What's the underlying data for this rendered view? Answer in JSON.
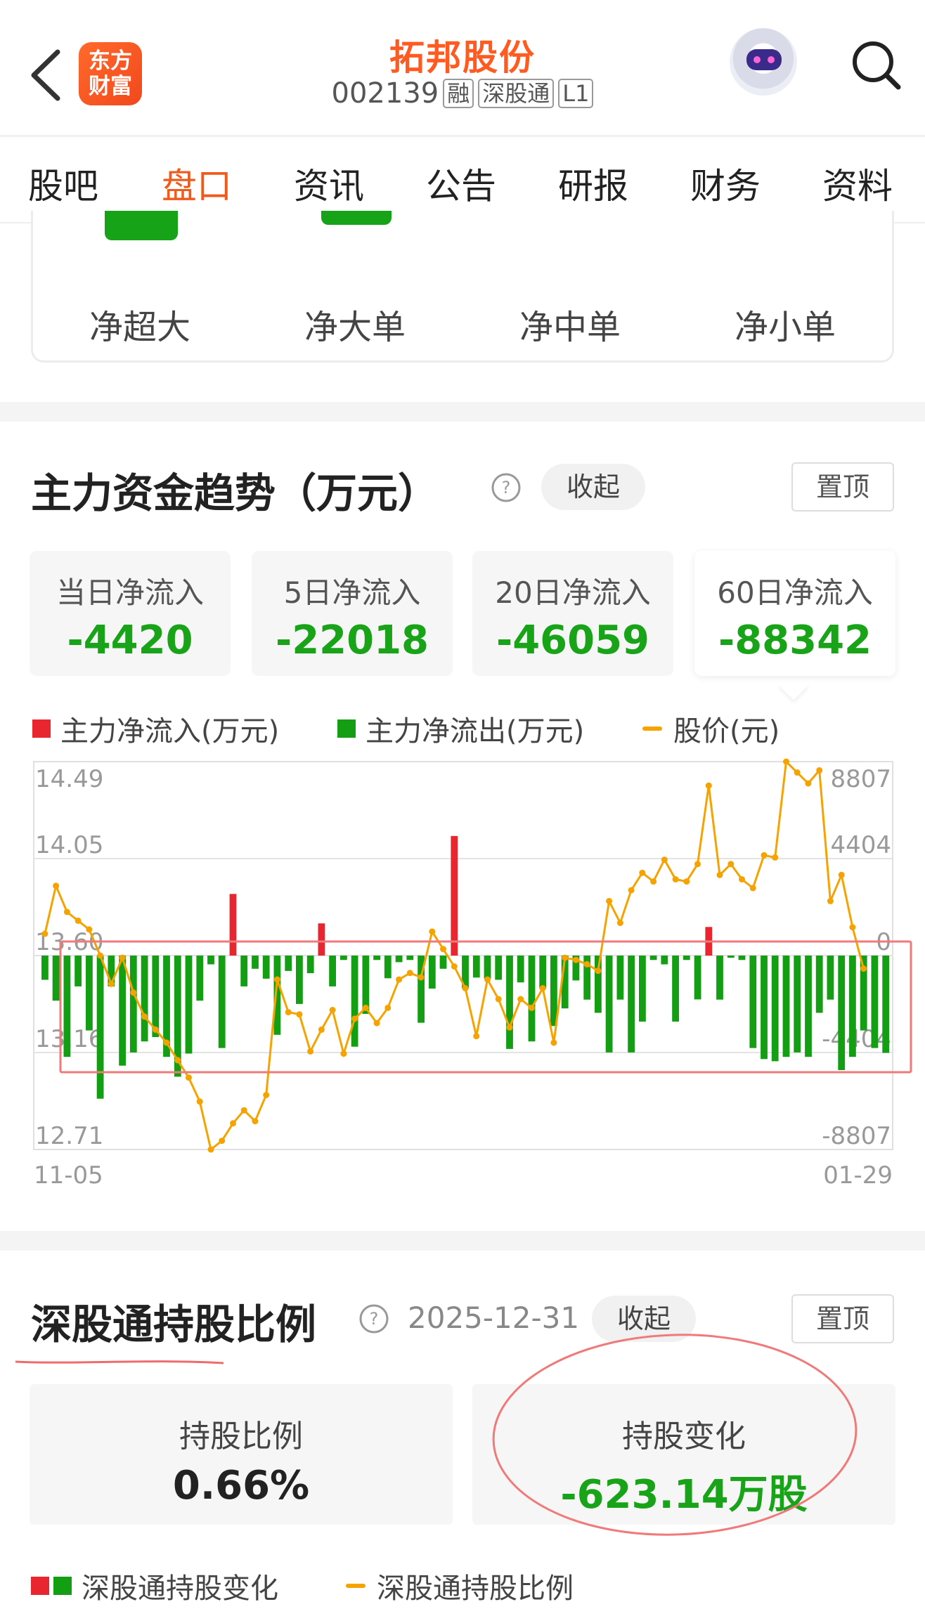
{
  "header": {
    "logo_line1": "东方",
    "logo_line2": "财富",
    "stock_name": "拓邦股份",
    "stock_code": "002139",
    "tags": [
      "融",
      "深股通",
      "L1"
    ]
  },
  "tabs": [
    "股吧",
    "盘口",
    "资讯",
    "公告",
    "研报",
    "财务",
    "资料"
  ],
  "active_tab": "盘口",
  "order_flow": {
    "labels": [
      "净超大",
      "净大单",
      "净中单",
      "净小单"
    ]
  },
  "main_flow": {
    "title": "主力资金趋势（万元）",
    "collapse_label": "收起",
    "pin_label": "置顶",
    "stats": [
      {
        "label": "当日净流入",
        "value": "-4420"
      },
      {
        "label": "5日净流入",
        "value": "-22018"
      },
      {
        "label": "20日净流入",
        "value": "-46059"
      },
      {
        "label": "60日净流入",
        "value": "-88342"
      }
    ],
    "legend": [
      {
        "label": "主力净流入(万元)",
        "color": "#e8262f",
        "kind": "square"
      },
      {
        "label": "主力净流出(万元)",
        "color": "#149e14",
        "kind": "square"
      },
      {
        "label": "股价(元)",
        "color": "#f5a300",
        "kind": "line"
      }
    ]
  },
  "chart_data": {
    "type": "bar",
    "title": "",
    "start_date": "11-05",
    "end_date": "01-29",
    "left_axis": {
      "label": "股价(元)",
      "ticks": [
        "14.49",
        "14.05",
        "13.60",
        "13.16",
        "12.71"
      ],
      "range": [
        12.71,
        14.49
      ]
    },
    "right_axis": {
      "label": "万元",
      "ticks": [
        "8807",
        "4404",
        "0",
        "-4404",
        "-8807"
      ],
      "range": [
        -8807,
        8807
      ]
    },
    "x_tick_labels": [
      "11-05",
      "01-29"
    ],
    "colors": {
      "inflow": "#e8262f",
      "outflow": "#149e14",
      "price": "#f5a300"
    },
    "series": [
      {
        "name": "主力净流入/净流出(万元)",
        "values": [
          -1100,
          -2050,
          -4600,
          -1400,
          -3400,
          -6500,
          -1400,
          -5000,
          -4400,
          -3900,
          -3700,
          -4600,
          -5500,
          -4450,
          -2050,
          -400,
          -4200,
          2800,
          -1400,
          -600,
          -1050,
          -3600,
          -700,
          -2200,
          -800,
          1460,
          -1400,
          -200,
          -4140,
          -2650,
          -200,
          -1030,
          -300,
          -200,
          -3050,
          -1500,
          -600,
          5430,
          -1500,
          -1000,
          -1050,
          -1100,
          -4240,
          -1220,
          -3900,
          -1500,
          -3200,
          -2400,
          -1130,
          -2000,
          -2600,
          -4400,
          -2000,
          -4400,
          -3000,
          -200,
          -400,
          -3000,
          -200,
          -1990,
          1300,
          -2000,
          -100,
          -200,
          -4200,
          -4700,
          -4800,
          -4600,
          -4400,
          -4600,
          -2600,
          -2000,
          -5200,
          -4600,
          -3400,
          -4200,
          -4420
        ]
      },
      {
        "name": "股价(元)",
        "values": [
          13.7,
          13.92,
          13.8,
          13.76,
          13.72,
          13.6,
          13.47,
          13.59,
          13.43,
          13.32,
          13.26,
          13.2,
          13.12,
          13.04,
          12.93,
          12.71,
          12.75,
          12.83,
          12.89,
          12.84,
          12.96,
          13.49,
          13.34,
          13.33,
          13.16,
          13.26,
          13.35,
          13.15,
          13.31,
          13.36,
          13.29,
          13.36,
          13.49,
          13.52,
          13.5,
          13.71,
          13.63,
          13.55,
          13.45,
          13.23,
          13.49,
          13.4,
          13.27,
          13.4,
          13.36,
          13.45,
          13.2,
          13.59,
          13.58,
          13.56,
          13.53,
          13.85,
          13.75,
          13.9,
          13.98,
          13.94,
          14.04,
          13.95,
          13.94,
          14.02,
          14.38,
          13.97,
          14.02,
          13.95,
          13.91,
          14.06,
          14.05,
          14.49,
          14.44,
          14.39,
          14.45,
          13.85,
          13.97,
          13.73,
          13.54
        ]
      }
    ]
  },
  "hk_connect": {
    "title": "深股通持股比例",
    "date": "2025-12-31",
    "collapse_label": "收起",
    "pin_label": "置顶",
    "ratio_label": "持股比例",
    "ratio_value": "0.66%",
    "change_label": "持股变化",
    "change_value": "-623.14万股",
    "change_color": "#18a318",
    "legend_change": "深股通持股变化",
    "legend_ratio": "深股通持股比例"
  }
}
